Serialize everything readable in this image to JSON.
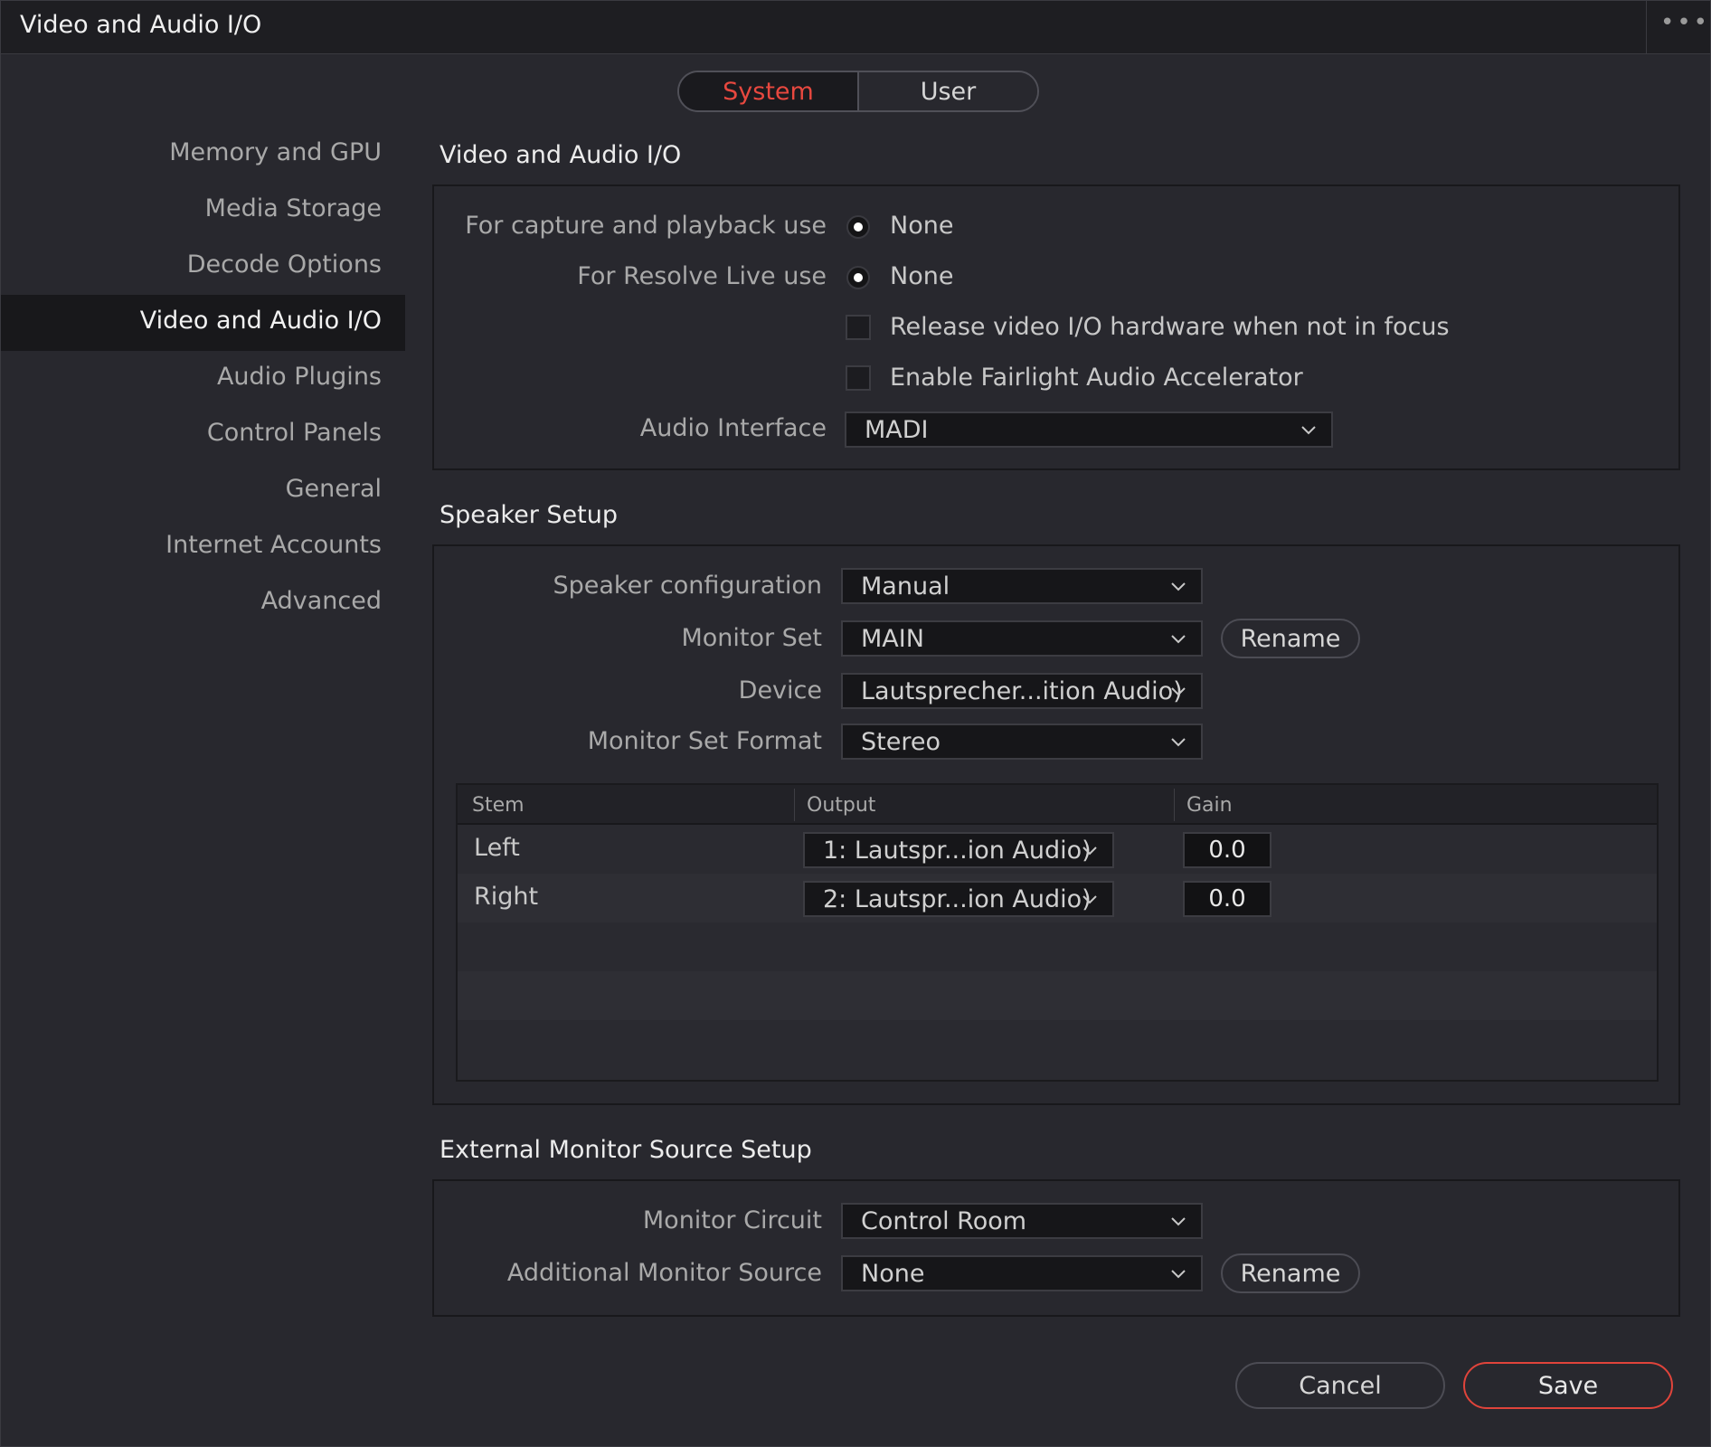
{
  "window": {
    "title": "Video and Audio I/O",
    "menu_icon": "more-dots-icon"
  },
  "tabs": {
    "system": "System",
    "user": "User",
    "active": "System"
  },
  "sidebar": {
    "items": [
      {
        "label": "Memory and GPU"
      },
      {
        "label": "Media Storage"
      },
      {
        "label": "Decode Options"
      },
      {
        "label": "Video and Audio I/O"
      },
      {
        "label": "Audio Plugins"
      },
      {
        "label": "Control Panels"
      },
      {
        "label": "General"
      },
      {
        "label": "Internet Accounts"
      },
      {
        "label": "Advanced"
      }
    ],
    "active": "Video and Audio I/O"
  },
  "video_io": {
    "title": "Video and Audio I/O",
    "capture_label": "For capture and playback use",
    "capture_value": "None",
    "resolve_live_label": "For Resolve Live use",
    "resolve_live_value": "None",
    "release_label": "Release video I/O hardware when not in focus",
    "release_checked": false,
    "fairlight_label": "Enable Fairlight Audio Accelerator",
    "fairlight_checked": false,
    "audio_interface_label": "Audio Interface",
    "audio_interface_value": "MADI"
  },
  "speaker_setup": {
    "title": "Speaker Setup",
    "config_label": "Speaker configuration",
    "config_value": "Manual",
    "monitor_set_label": "Monitor Set",
    "monitor_set_value": "MAIN",
    "rename_label": "Rename",
    "device_label": "Device",
    "device_value": "Lautsprecher...ition Audio)",
    "format_label": "Monitor Set Format",
    "format_value": "Stereo",
    "table": {
      "headers": {
        "stem": "Stem",
        "output": "Output",
        "gain": "Gain"
      },
      "rows": [
        {
          "stem": "Left",
          "output": "1: Lautspr...ion Audio)",
          "gain": "0.0"
        },
        {
          "stem": "Right",
          "output": "2: Lautspr...ion Audio)",
          "gain": "0.0"
        }
      ]
    }
  },
  "external_monitor": {
    "title": "External Monitor Source Setup",
    "circuit_label": "Monitor Circuit",
    "circuit_value": "Control Room",
    "additional_label": "Additional Monitor Source",
    "additional_value": "None",
    "rename_label": "Rename"
  },
  "footer": {
    "cancel": "Cancel",
    "save": "Save"
  },
  "colors": {
    "accent": "#e8483f",
    "background": "#28282e",
    "titlebar": "#1e1e22"
  }
}
